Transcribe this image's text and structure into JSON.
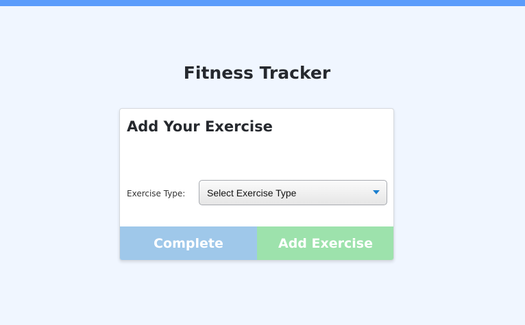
{
  "app": {
    "title": "Fitness Tracker",
    "colors": {
      "top_bar": "#5b9cfb",
      "background": "#f0f6ff",
      "complete_button": "#9fc8ea",
      "add_button": "#9de2ac",
      "select_arrow": "#1a7fcf"
    }
  },
  "card": {
    "title": "Add Your Exercise",
    "exercise_type_label": "Exercise Type:",
    "exercise_type_select": {
      "selected": "Select Exercise Type",
      "icon": "caret-down-icon"
    }
  },
  "buttons": {
    "complete_label": "Complete",
    "add_exercise_label": "Add Exercise"
  }
}
